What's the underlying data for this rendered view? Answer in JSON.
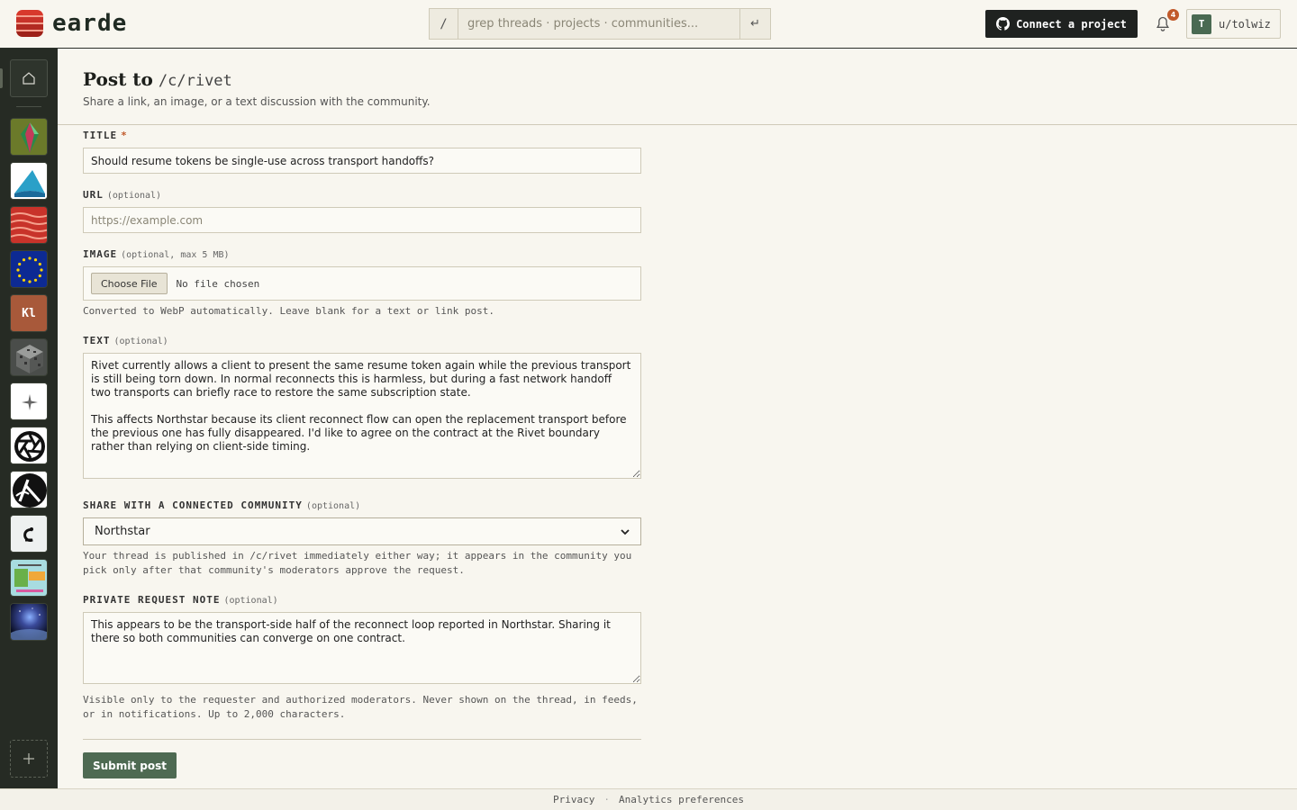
{
  "app": {
    "name": "earde"
  },
  "search": {
    "prefix": "/",
    "placeholder": "grep threads · projects · communities...",
    "enter_glyph": "↵"
  },
  "header": {
    "connect_label": "Connect a project",
    "notification_count": "4",
    "user": {
      "initial": "T",
      "name": "u/tolwiz"
    }
  },
  "sidebar": {
    "communities": [
      {
        "name": "crystal",
        "color": "#6b7a2a"
      },
      {
        "name": "fin",
        "color": "#ffffff"
      },
      {
        "name": "earde",
        "color": "#c8332a"
      },
      {
        "name": "eu",
        "color": "#0d2a93"
      },
      {
        "name": "kl",
        "label": "Kl",
        "color": "#a8593a"
      },
      {
        "name": "stone",
        "color": "#6a6e6a"
      },
      {
        "name": "northstar",
        "color": "#ffffff"
      },
      {
        "name": "aperture",
        "color": "#ffffff"
      },
      {
        "name": "lambda",
        "color": "#ffffff"
      },
      {
        "name": "hook",
        "color": "#f0f0f0"
      },
      {
        "name": "goodday",
        "color": "#9bd3d8"
      },
      {
        "name": "space",
        "color": "#1a2a4a"
      }
    ]
  },
  "page": {
    "title": "Post to",
    "community": "/c/rivet",
    "subtitle": "Share a link, an image, or a text discussion with the community."
  },
  "form": {
    "title_label": "TITLE",
    "title_required": "*",
    "title_value": "Should resume tokens be single-use across transport handoffs?",
    "url_label": "URL",
    "url_optional": "(optional)",
    "url_placeholder": "https://example.com",
    "image_label": "IMAGE",
    "image_optional": "(optional, max 5 MB)",
    "file_button": "Choose File",
    "file_status": "No file chosen",
    "image_help": "Converted to WebP automatically. Leave blank for a text or link post.",
    "text_label": "TEXT",
    "text_optional": "(optional)",
    "text_value": "Rivet currently allows a client to present the same resume token again while the previous transport is still being torn down. In normal reconnects this is harmless, but during a fast network handoff two transports can briefly race to restore the same subscription state.\n\nThis affects Northstar because its client reconnect flow can open the replacement transport before the previous one has fully disappeared. I'd like to agree on the contract at the Rivet boundary rather than relying on client-side timing.",
    "share_label": "SHARE WITH A CONNECTED COMMUNITY",
    "share_optional": "(optional)",
    "share_value": "Northstar",
    "share_help": "Your thread is published in /c/rivet immediately either way; it appears in the community you pick only after that community's moderators approve the request.",
    "note_label": "PRIVATE REQUEST NOTE",
    "note_optional": "(optional)",
    "note_value": "This appears to be the transport-side half of the reconnect loop reported in Northstar. Sharing it there so both communities can converge on one contract.",
    "note_help": "Visible only to the requester and authorized moderators. Never shown on the thread, in feeds, or in notifications. Up to 2,000 characters.",
    "submit_label": "Submit post"
  },
  "footer": {
    "privacy": "Privacy",
    "separator": "·",
    "analytics": "Analytics preferences"
  }
}
